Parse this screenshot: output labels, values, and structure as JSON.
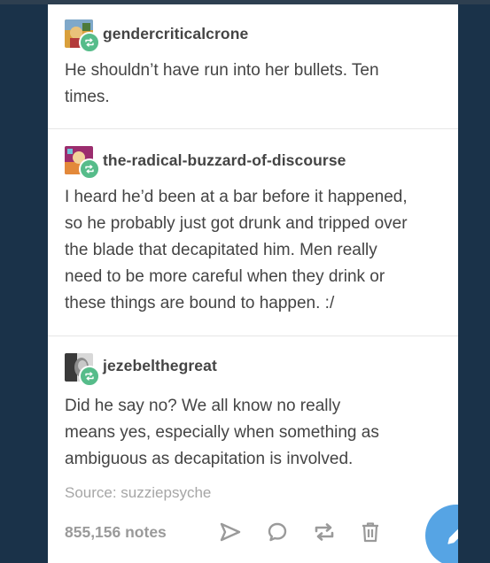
{
  "posts": [
    {
      "username": "gendercriticalcrone",
      "lines": [
        "He shouldn’t have run into her bullets.  Ten",
        "times."
      ]
    },
    {
      "username": "the-radical-buzzard-of-discourse",
      "lines": [
        "I heard he’d been at a bar before it happened,",
        "so he probably just got drunk and tripped over",
        "the blade that decapitated him. Men really",
        "need to be more careful when they drink or",
        "these things are bound to happen. :/"
      ]
    },
    {
      "username": "jezebelthegreat",
      "lines": [
        "Did he say no? We all know no really",
        "means yes, especially when something as",
        "ambiguous as decapitation is involved."
      ]
    }
  ],
  "source": "Source: suzziepsyche",
  "notes": "855,156 notes",
  "icons": {
    "reblog_badge": "reblog-icon",
    "share": "send-icon",
    "reply": "reply-icon",
    "reblog": "reblog-icon",
    "delete": "trash-icon",
    "compose": "pencil-icon"
  },
  "colors": {
    "background": "#1a3249",
    "reblog_green": "#56bc8a",
    "compose_blue": "#56a4e4",
    "text": "#444444",
    "muted": "#9a9a9a"
  }
}
